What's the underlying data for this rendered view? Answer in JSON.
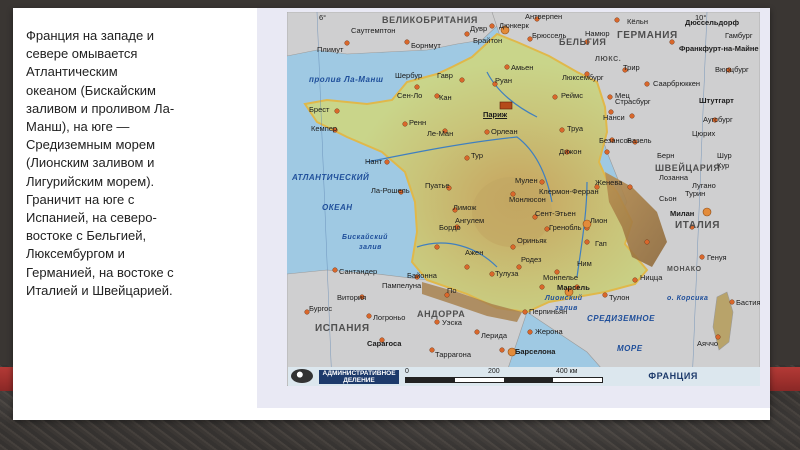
{
  "description_text": "Франция на западе и\nсевере омывается\nАтлантическим\nокеаном (Бискайским\nзаливом и проливом Ла-\nМанш), на юге —\nСредиземным морем\n(Лионским заливом и\nЛигурийским морем).\nГраничит на юге с\nИспанией, на северо-\nвостоке с Бельгией,\nЛюксембургом и\nГерманией, на востоке с\nИталией и Швейцарией.",
  "map": {
    "countries": {
      "uk": "ВЕЛИКОБРИТАНИЯ",
      "belgium": "БЕЛЬГИЯ",
      "germany": "ГЕРМАНИЯ",
      "switzerland": "ШВЕЙЦАРИЯ",
      "italy": "ИТАЛИЯ",
      "spain": "ИСПАНИЯ",
      "andorra": "АНДОРРА",
      "monaco": "МОНАКО",
      "lux": "ЛЮКС."
    },
    "seas": {
      "channel": "пролив Ла-Манш",
      "atlantic1": "АТЛАНТИЧЕСКИЙ",
      "atlantic2": "ОКЕАН",
      "biscay1": "Бискайский",
      "biscay2": "залив",
      "lion1": "Лионский",
      "lion2": "залив",
      "med1": "СРЕДИЗЕМНОЕ",
      "med2": "МОРЕ",
      "corsica": "о. Корсика"
    },
    "cities": {
      "capital": "Париж",
      "c01": "Саутгемптон",
      "c02": "Борнмут",
      "c03": "Плимут",
      "c04": "Дувр",
      "c05": "Брайтон",
      "c06": "Дюнкерк",
      "c07": "Антверпен",
      "c08": "Брюссель",
      "c09": "Дюссельдорф",
      "c10": "Франкфурт-на-Майне",
      "c11": "Кёльн",
      "c12": "Вюрцбург",
      "c13": "Амьен",
      "c14": "Гавр",
      "c15": "Руан",
      "c16": "Шербур",
      "c17": "Сен-Ло",
      "c18": "Кан",
      "c19": "Люксембург",
      "c20": "Намюр",
      "c21": "Трир",
      "c22": "Саарбрюккен",
      "c23": "Реймс",
      "c24": "Мец",
      "c25": "Нанси",
      "c26": "Страсбург",
      "c27": "Штутгарт",
      "c28": "Аугсбург",
      "c29": "Брест",
      "c30": "Кемпер",
      "c31": "Ренн",
      "c32": "Ле-Ман",
      "c33": "Орлеан",
      "c34": "Труа",
      "c35": "Дижон",
      "c36": "Безансон",
      "c37": "Цюрих",
      "c38": "Базель",
      "c39": "Берн",
      "c40": "Нант",
      "c41": "Тур",
      "c42": "Пуатье",
      "c43": "Мулен",
      "c44": "Лион",
      "c45": "Женева",
      "c46": "Лозанна",
      "c47": "Монлюсон",
      "c48": "Ла-Рошель",
      "c49": "Лимож",
      "c50": "Клермон-Ферран",
      "c51": "Сент-Этьен",
      "c52": "Ангулем",
      "c53": "Гренобль",
      "c54": "Бордо",
      "c55": "Ориньяк",
      "c56": "Милан",
      "c57": "Турин",
      "c58": "Генуя",
      "c59": "Ажен",
      "c60": "Родез",
      "c61": "Ним",
      "c62": "Монпелье",
      "c63": "Марсель",
      "c64": "Ницца",
      "c65": "Тулон",
      "c66": "Байонна",
      "c67": "Тулуза",
      "c68": "По",
      "c69": "Сантандер",
      "c70": "Витория",
      "c71": "Бургос",
      "c72": "Логроньо",
      "c73": "Перпиньян",
      "c74": "Уэска",
      "c75": "Лерида",
      "c76": "Сарагоса",
      "c77": "Таррагона",
      "c78": "Барселона",
      "c79": "Жерона",
      "c80": "Бастия",
      "c81": "Аяччо",
      "c82": "Гап",
      "c83": "Гамбург",
      "c84": "Сьон",
      "c85": "Лугано",
      "c86": "Шур",
      "c87": "Кур",
      "c88": "Пампелуна"
    },
    "legend": {
      "admin_label": "АДМИНИСТРАТИВНОЕ ДЕЛЕНИЕ",
      "scale_0": "0",
      "scale_200": "200",
      "scale_400": "400 км",
      "country": "ФРАНЦИЯ"
    },
    "graticule": {
      "lon_w": "6°",
      "lon_e": "10°"
    }
  },
  "colors": {
    "sea": "#9fc9e3",
    "france_lowland": "#c9d58a",
    "france_upland": "#b8c77b",
    "mountains": "#c49a5a",
    "neighbors": "#cfcfd0",
    "border": "#e0b84a",
    "band": "#b33a36"
  }
}
